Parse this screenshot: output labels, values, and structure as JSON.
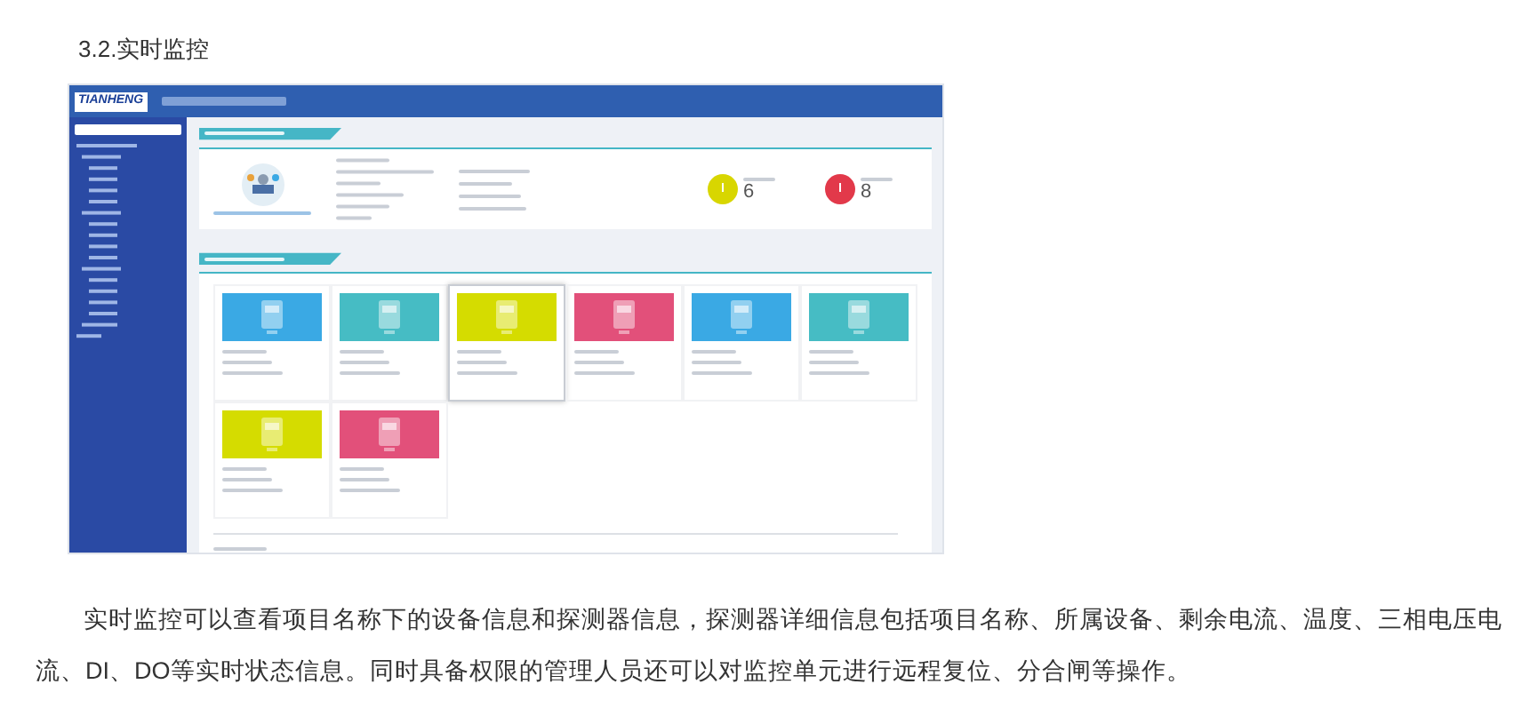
{
  "heading": "3.2.实时监控",
  "screenshot": {
    "logo": "TIANHENG",
    "stats": [
      {
        "value": "6",
        "color": "#d8d600"
      },
      {
        "value": "8",
        "color": "#e2394a"
      }
    ],
    "devices": [
      {
        "color": "#3aa9e4",
        "selected": false
      },
      {
        "color": "#46bcc4",
        "selected": false
      },
      {
        "color": "#d5dc00",
        "selected": true
      },
      {
        "color": "#e2507a",
        "selected": false
      },
      {
        "color": "#3aa9e4",
        "selected": false
      },
      {
        "color": "#46bcc4",
        "selected": false
      },
      {
        "color": "#d5dc00",
        "selected": false
      },
      {
        "color": "#e2507a",
        "selected": false
      }
    ]
  },
  "paragraph": "实时监控可以查看项目名称下的设备信息和探测器信息，探测器详细信息包括项目名称、所属设备、剩余电流、温度、三相电压电流、DI、DO等实时状态信息。同时具备权限的管理人员还可以对监控单元进行远程复位、分合闸等操作。"
}
